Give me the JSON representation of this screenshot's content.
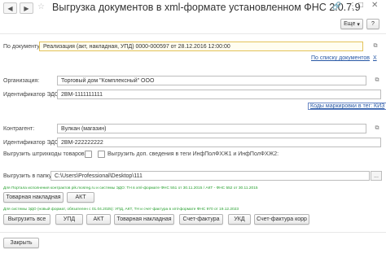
{
  "window": {
    "title": "Выгрузка документов в xml-формате установленном ФНС   2.0.7.9",
    "more_label": "Еще"
  },
  "document": {
    "label": "По документу:",
    "value": "Реализация (акт, накладная, УПД) 0000-000597 от 28.12.2016 12:00:00",
    "list_link": "По списку документов",
    "close_link": "X"
  },
  "org": {
    "org_label": "Организация:",
    "org_value": "Торговый дом \"Комплексный\" ООО",
    "edo_label": "Идентификатор ЭДО:",
    "edo_value": "2ВМ-1111111111",
    "codes_link": "Коды маркировки в тег: КИЗ"
  },
  "counterparty": {
    "label": "Контрагент:",
    "value": "Вулкан (магазин)",
    "edo_label": "Идентификатор ЭДО:",
    "edo_value": "2ВМ-222222222"
  },
  "options": {
    "barcodes_label": "Выгрузить штрихкоды товаров:",
    "extra_label": "Выгрузить доп. сведения в теги ИнфПолФХЖ1 и ИнфПолФХЖ2:"
  },
  "export": {
    "folder_label": "Выгрузить в папку:",
    "folder_value": "C:\\Users\\Professional\\Desktop\\111"
  },
  "section1": {
    "note": "Для Портала исполнения контрактов pik.mosreg.ru и системы ЭДО: ТН в xml-формате ФНС 551 от 30.11.2015 / АКТ - ФНС 552 от 30.11.2015",
    "buttons": [
      "Товарная накладная",
      "АКТ"
    ]
  },
  "section2": {
    "note": "Для системы ЭДО (новый формат, обязателен с 01.04.2025): УПД, АКТ, ТН и счет-фактура в xml-формате ФНС 970 от 19.12.2023",
    "buttons": [
      "Выгрузить все",
      "УПД",
      "АКТ",
      "Товарная накладная",
      "Счет-фактура",
      "УКД",
      "Счет-фактура корр"
    ]
  },
  "footer": {
    "close_label": "Закрыть"
  },
  "colors": {
    "link": "#2858a5",
    "note_green": "#27a02f",
    "highlight_border": "#e3c25a"
  },
  "icons": {
    "back": "back-arrow-icon",
    "forward": "forward-arrow-icon",
    "star": "star-icon",
    "link": "link-icon",
    "menu": "kebab-menu-icon",
    "close": "close-icon",
    "help": "help-icon"
  }
}
